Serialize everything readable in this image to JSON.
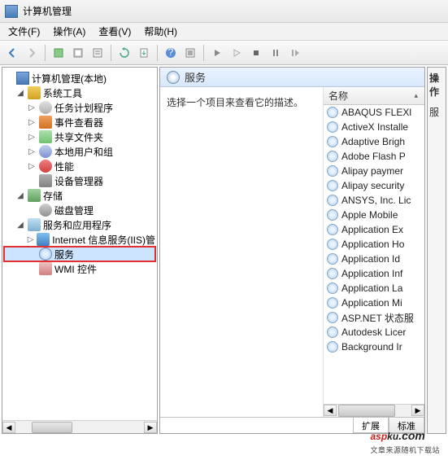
{
  "title": "计算机管理",
  "menus": {
    "file": "文件(F)",
    "action": "操作(A)",
    "view": "查看(V)",
    "help": "帮助(H)"
  },
  "tree": {
    "root": "计算机管理(本地)",
    "sys_tools": "系统工具",
    "task": "任务计划程序",
    "event": "事件查看器",
    "share": "共享文件夹",
    "users": "本地用户和组",
    "perf": "性能",
    "device": "设备管理器",
    "storage": "存储",
    "disk": "磁盘管理",
    "apps": "服务和应用程序",
    "iis": "Internet 信息服务(IIS)管",
    "services": "服务",
    "wmi": "WMI 控件"
  },
  "pane": {
    "title": "服务",
    "desc": "选择一个项目来查看它的描述。",
    "col_name": "名称"
  },
  "actions": {
    "header": "操作",
    "item1": "服"
  },
  "tabs": {
    "extended": "扩展",
    "standard": "标准"
  },
  "services": [
    "ABAQUS FLEXl",
    "ActiveX Installe",
    "Adaptive Brigh",
    "Adobe Flash P",
    "Alipay paymer",
    "Alipay security",
    "ANSYS, Inc. Lic",
    "Apple Mobile",
    "Application Ex",
    "Application Ho",
    "Application Id",
    "Application Inf",
    "Application La",
    "Application Mi",
    "ASP.NET 状态服",
    "Autodesk Licer",
    "Background Ir"
  ],
  "watermark": {
    "brand1": "asp",
    "brand2": "ku",
    "dot": ".com",
    "sub": "文章来源随机下载站"
  }
}
